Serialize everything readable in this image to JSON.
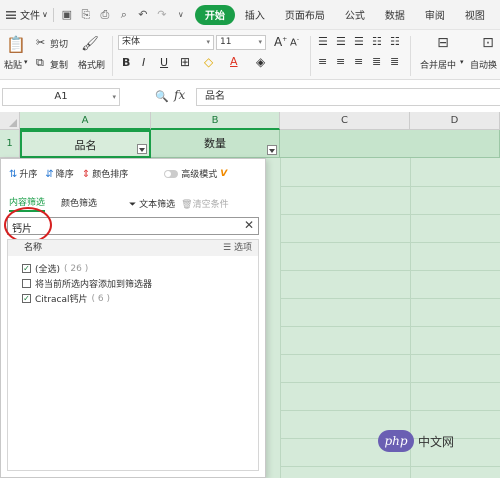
{
  "menubar": {
    "file_label": "文件",
    "tabs": [
      "开始",
      "插入",
      "页面布局",
      "公式",
      "数据",
      "审阅",
      "视图"
    ],
    "active_tab": "开始"
  },
  "ribbon": {
    "paste": "粘贴",
    "cut": "剪切",
    "copy": "复制",
    "format_painter": "格式刷",
    "font_name": "宋体",
    "font_size": "11",
    "merge_center": "合并居中",
    "auto_wrap": "自动换"
  },
  "formula_bar": {
    "cell_ref": "A1",
    "fx_label": "fx",
    "value": "品名"
  },
  "grid": {
    "columns": [
      "A",
      "B",
      "C",
      "D"
    ],
    "row1_number": "1",
    "a1": "品名",
    "b1": "数量"
  },
  "filter": {
    "sort_asc": "升序",
    "sort_desc": "降序",
    "color_sort": "颜色排序",
    "advanced_mode": "高级模式",
    "vip_mark": "V",
    "tab_content": "内容筛选",
    "tab_color": "颜色筛选",
    "text_filter": "文本筛选",
    "clear_conditions": "清空条件",
    "search_value": "钙片",
    "list_header": "名称",
    "options": "选项",
    "items": [
      {
        "label": "(全选)",
        "count": "( 26 )",
        "checked": true
      },
      {
        "label": "将当前所选内容添加到筛选器",
        "count": "",
        "checked": false
      },
      {
        "label": "Citracal钙片",
        "count": "( 6 )",
        "checked": true
      }
    ]
  },
  "watermark": {
    "logo": "php",
    "text": "中文网"
  },
  "colors": {
    "accent": "#1a9e48",
    "sheet_fill": "#d5ead9",
    "annotation": "#d62020"
  }
}
